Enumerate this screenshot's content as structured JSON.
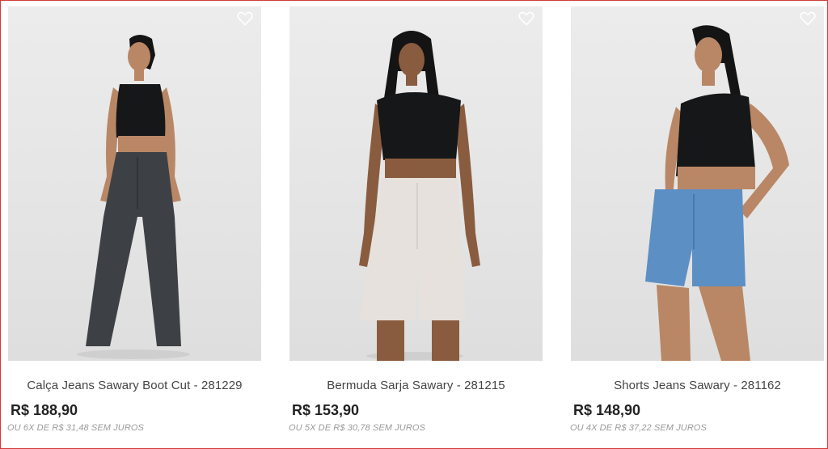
{
  "products": [
    {
      "name": "Calça Jeans Sawary Boot Cut - 281229",
      "price": "R$ 188,90",
      "installments": "OU 6X DE R$ 31,48 SEM JUROS",
      "image_icon": "model-wearing-bootcut-jeans",
      "bottom_color": "#3d4146"
    },
    {
      "name": "Bermuda Sarja Sawary - 281215",
      "price": "R$ 153,90",
      "installments": "OU 5X DE R$ 30,78 SEM JUROS",
      "image_icon": "model-wearing-white-bermuda",
      "bottom_color": "#e6e1dc"
    },
    {
      "name": "Shorts Jeans Sawary - 281162",
      "price": "R$ 148,90",
      "installments": "OU 4X DE R$ 37,22 SEM JUROS",
      "image_icon": "model-wearing-denim-shorts",
      "bottom_color": "#5c8fc4"
    }
  ],
  "colors": {
    "frame_border": "#d33a3a",
    "top_color": "#161719",
    "skin_color": "#b98765",
    "hair_color": "#141414"
  }
}
